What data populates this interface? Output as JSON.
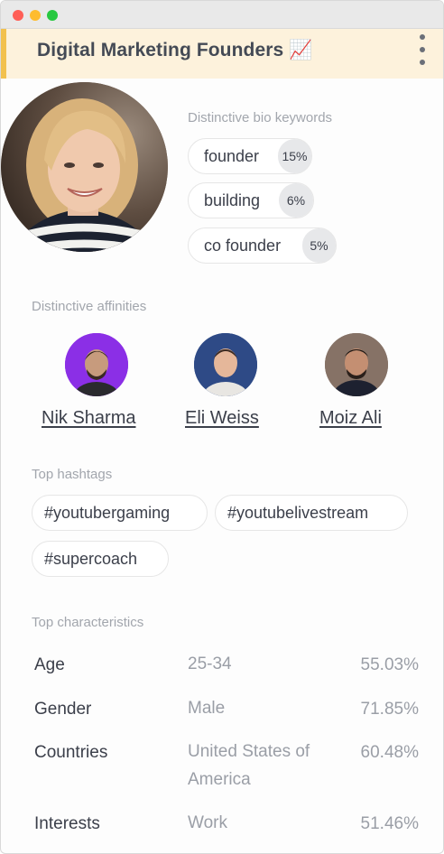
{
  "header": {
    "title": "Digital Marketing Founders 📈"
  },
  "bio": {
    "label": "Distinctive bio keywords",
    "keywords": [
      {
        "word": "founder",
        "pct": "15%"
      },
      {
        "word": "building",
        "pct": "6%"
      },
      {
        "word": "co founder",
        "pct": "5%"
      }
    ]
  },
  "affinities": {
    "label": "Distinctive affinities",
    "people": [
      {
        "name": "Nik Sharma"
      },
      {
        "name": "Eli Weiss"
      },
      {
        "name": "Moiz Ali"
      }
    ]
  },
  "hashtags": {
    "label": "Top hashtags",
    "items": [
      "#youtubergaming",
      "#youtubelivestream",
      "#supercoach"
    ]
  },
  "characteristics": {
    "label": "Top characteristics",
    "rows": [
      {
        "key": "Age",
        "value": "25-34",
        "pct": "55.03%"
      },
      {
        "key": "Gender",
        "value": "Male",
        "pct": "71.85%"
      },
      {
        "key": "Countries",
        "value": "United States of America",
        "pct": "60.48%"
      },
      {
        "key": "Interests",
        "value": "Work",
        "pct": "51.46%"
      }
    ]
  },
  "colors": {
    "accent": "#f2c14e",
    "header_bg": "#fdf2dc"
  },
  "icons": [
    "chart-increasing-emoji",
    "more-vertical-icon"
  ]
}
